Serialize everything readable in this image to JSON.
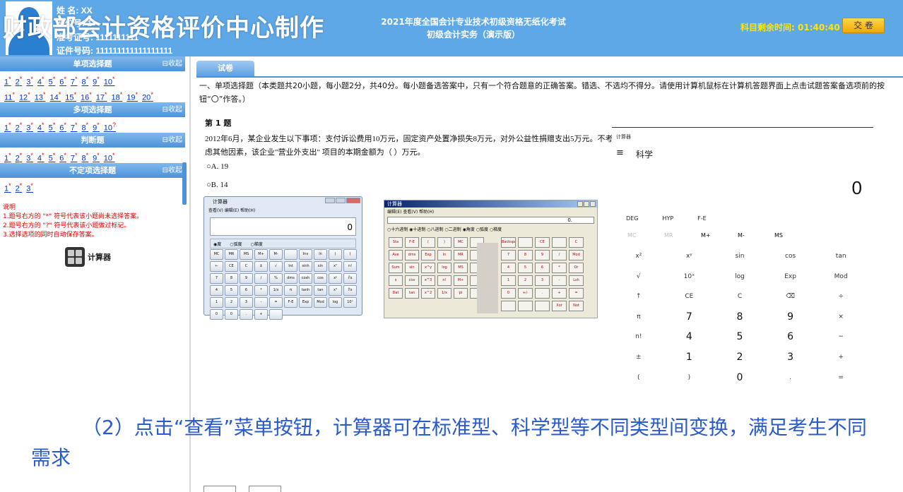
{
  "header": {
    "name_line": "姓    名: XX",
    "seat_line": "座位号: 1",
    "ticket_line": "准考证号: 1111111111",
    "id_line": "证件号码: 111111111111111111",
    "overlay_title": "财政部会计资格评价中心制作",
    "exam_title_line1": "2021年度全国会计专业技术初级资格无纸化考试",
    "exam_title_line2": "初级会计实务（演示版）",
    "timer_label": "科目剩余时间:",
    "timer_value": "01:40:40",
    "submit_label": "交 卷"
  },
  "sidebar": {
    "collapse_label": "⊟收起",
    "sections": [
      {
        "title": "单项选择题",
        "rows": [
          [
            {
              "n": "1",
              "m": "*"
            },
            {
              "n": "2",
              "m": "*"
            },
            {
              "n": "3",
              "m": "*"
            },
            {
              "n": "4",
              "m": "*"
            },
            {
              "n": "5",
              "m": "*"
            },
            {
              "n": "6",
              "m": "*"
            },
            {
              "n": "7",
              "m": "*"
            },
            {
              "n": "8",
              "m": "*"
            },
            {
              "n": "9",
              "m": "*"
            },
            {
              "n": "10",
              "m": "*"
            }
          ],
          [
            {
              "n": "11",
              "m": "*"
            },
            {
              "n": "12",
              "m": "*"
            },
            {
              "n": "13",
              "m": "*"
            },
            {
              "n": "14",
              "m": "*"
            },
            {
              "n": "15",
              "m": "*"
            },
            {
              "n": "16",
              "m": "*"
            },
            {
              "n": "17",
              "m": "*"
            },
            {
              "n": "18",
              "m": "*"
            },
            {
              "n": "19",
              "m": "*"
            },
            {
              "n": "20",
              "m": "*"
            }
          ]
        ]
      },
      {
        "title": "多项选择题",
        "rows": [
          [
            {
              "n": "1",
              "m": "*"
            },
            {
              "n": "2",
              "m": "*"
            },
            {
              "n": "3",
              "m": "*"
            },
            {
              "n": "4",
              "m": "*"
            },
            {
              "n": "5",
              "m": "*"
            },
            {
              "n": "6",
              "m": "*"
            },
            {
              "n": "7",
              "m": "*"
            },
            {
              "n": "8",
              "m": "*"
            },
            {
              "n": "9",
              "m": "*"
            },
            {
              "n": "10",
              "m": "?"
            }
          ]
        ]
      },
      {
        "title": "判断题",
        "rows": [
          [
            {
              "n": "1",
              "m": "*"
            },
            {
              "n": "2",
              "m": "*"
            },
            {
              "n": "3",
              "m": "*"
            },
            {
              "n": "4",
              "m": "*"
            },
            {
              "n": "5",
              "m": "*"
            },
            {
              "n": "6",
              "m": "*"
            },
            {
              "n": "7",
              "m": "*"
            },
            {
              "n": "8",
              "m": "*"
            },
            {
              "n": "9",
              "m": "*"
            },
            {
              "n": "10",
              "m": "*"
            }
          ]
        ]
      },
      {
        "title": "不定项选择题",
        "rows": [
          [
            {
              "n": "1",
              "m": "*"
            },
            {
              "n": "2",
              "m": "*"
            },
            {
              "n": "3",
              "m": "*"
            }
          ]
        ]
      }
    ],
    "notes": [
      "说明",
      "1.题号右方的 \"*\" 符号代表该小题尚未选择答案。",
      "2.题号右方的 \"?\" 符号代表该小题做过标记。",
      "3.选择选项的同时自动保存答案。"
    ],
    "calculator_label": "计算器"
  },
  "main": {
    "tab_label": "试卷",
    "instruction": "一、单项选择题（本类题共20小题，每小题2分，共40分。每小题备选答案中，只有一个符合题意的正确答案。错选、不选均不得分。请使用计算机鼠标在计算机答题界面上点击试题答案备选项前的按钮“〇”作答。）",
    "question_title": "第 1 题",
    "question_text": "2012年6月，某企业发生以下事项：支付诉讼费用10万元，固定资产处置净损失8万元，对外公益性捐赠支出5万元。不考虑其他因素，该企业\"营业外支出\" 项目的本期金额为（     ）万元。",
    "options": [
      "○A. 19",
      "○B. 14"
    ]
  },
  "calc1": {
    "title": "计算器",
    "menu": "查看(V)   编辑(E)   帮助(H)",
    "display": "0",
    "radios": [
      "◉度",
      "○弧度",
      "○梯度"
    ],
    "keys": [
      "MC",
      "MR",
      "MS",
      "M+",
      "M-",
      "",
      "Inv",
      "ln",
      "(",
      ")",
      "←",
      "CE",
      "C",
      "±",
      "√",
      "Int",
      "sinh",
      "sin",
      "x²",
      "n!",
      "7",
      "8",
      "9",
      "/",
      "%",
      "dms",
      "cosh",
      "cos",
      "xʸ",
      "∛x",
      "4",
      "5",
      "6",
      "*",
      "1/x",
      "π",
      "tanh",
      "tan",
      "x³",
      "∜x",
      "1",
      "2",
      "3",
      "-",
      "=",
      "F-E",
      "Exp",
      "Mod",
      "log",
      "10ˣ",
      "0",
      "0",
      ".",
      "+",
      ""
    ]
  },
  "calc2": {
    "title": "计算器",
    "menu": "编辑(E)  查看(V)  帮助(H)",
    "display": "0.",
    "radios": "○十六进制 ◉十进制 ○八进制 ○二进制  ◉角度 ○弧度 ○梯度",
    "left_keys": [
      "Sta",
      "F-E",
      "(",
      ")",
      "MC",
      "",
      "Ave",
      "dms",
      "Exp",
      "ln",
      "MR",
      "",
      "Sum",
      "sin",
      "x^y",
      "log",
      "MS",
      "",
      "s",
      "cos",
      "x^3",
      "n!",
      "M+",
      "",
      "Dat",
      "tan",
      "x^2",
      "1/x",
      "pi",
      ""
    ],
    "right_keys": [
      "Backspace",
      "",
      "CE",
      "",
      "C",
      "7",
      "8",
      "9",
      "/",
      "Mod",
      "4",
      "5",
      "6",
      "*",
      "Or",
      "1",
      "2",
      "3",
      "-",
      "Lsh",
      "0",
      "+/-",
      ".",
      "+",
      "=",
      "",
      "",
      "",
      "Xor",
      "Not"
    ]
  },
  "calc3": {
    "title": "计算器",
    "menu_icon": "≡",
    "mode": "科学",
    "display": "0",
    "angle_modes": [
      "DEG",
      "HYP",
      "F-E"
    ],
    "memory": [
      "MC",
      "MR",
      "M+",
      "M-",
      "MS"
    ],
    "keys": [
      "x²",
      "xʸ",
      "sin",
      "cos",
      "tan",
      "√",
      "10ˣ",
      "log",
      "Exp",
      "Mod",
      "↑",
      "CE",
      "C",
      "⌫",
      "÷",
      "π",
      "7",
      "8",
      "9",
      "×",
      "n!",
      "4",
      "5",
      "6",
      "−",
      "±",
      "1",
      "2",
      "3",
      "+",
      "(",
      ")",
      "0",
      ".",
      "="
    ]
  },
  "subtitle": "（2）点击“查看”菜单按钮，计算器可在标准型、科学型等不同类型间变换，满足考生不同需求"
}
